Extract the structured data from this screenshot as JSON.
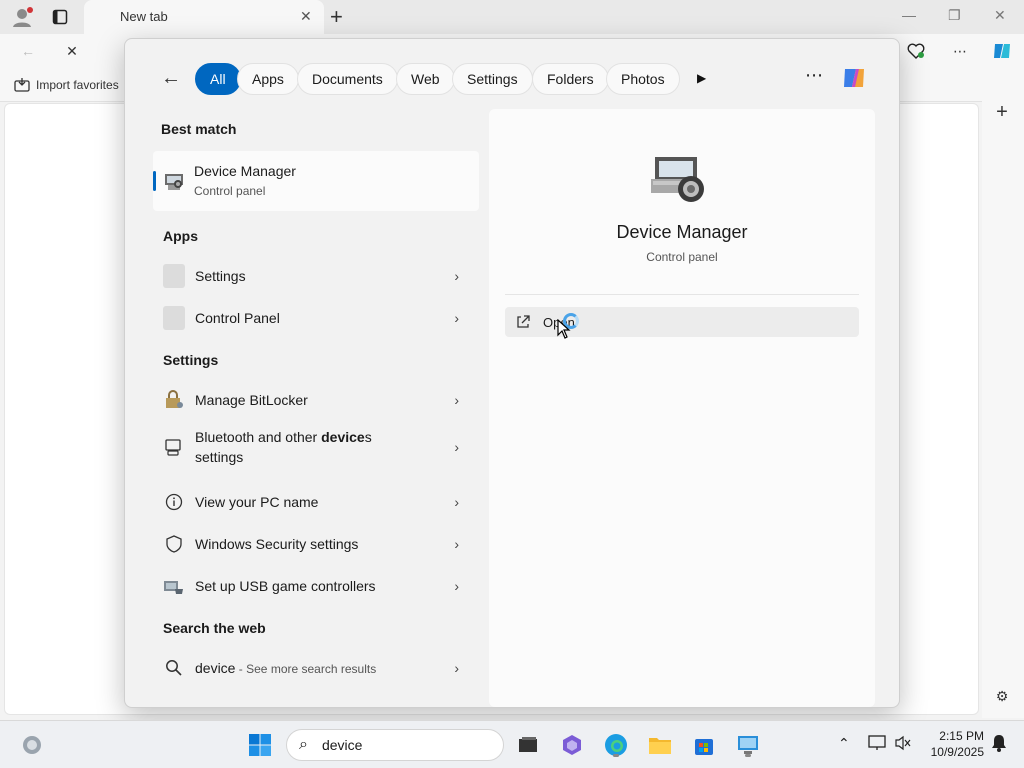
{
  "browser": {
    "tab_title": "New tab",
    "favorites_import": "Import favorites"
  },
  "search": {
    "filters": [
      "All",
      "Apps",
      "Documents",
      "Web",
      "Settings",
      "Folders",
      "Photos"
    ],
    "active_filter": "All",
    "best_match_heading": "Best match",
    "best_match": {
      "title": "Device Manager",
      "subtitle": "Control panel"
    },
    "apps_heading": "Apps",
    "apps": [
      {
        "label": "Settings"
      },
      {
        "label": "Control Panel"
      }
    ],
    "settings_heading": "Settings",
    "settings": [
      {
        "label": "Manage BitLocker",
        "icon": "bitlocker-icon"
      },
      {
        "label_pre": "Bluetooth and other ",
        "label_bold": "device",
        "label_post": "s",
        "label_line2": "settings",
        "icon": "bluetooth-devices-icon"
      },
      {
        "label": "View your PC name",
        "icon": "info-icon"
      },
      {
        "label": "Windows Security settings",
        "icon": "shield-icon"
      },
      {
        "label": "Set up USB game controllers",
        "icon": "game-controller-icon"
      }
    ],
    "web_heading": "Search the web",
    "web_result": {
      "query": "device",
      "suffix": " - See more search results"
    }
  },
  "details": {
    "title": "Device Manager",
    "subtitle": "Control panel",
    "open_label": "Open"
  },
  "taskbar": {
    "search_text": "device",
    "time": "2:15 PM",
    "date": "10/9/2025"
  },
  "colors": {
    "accent": "#0067c0",
    "panel_bg": "#f2f2f2"
  }
}
